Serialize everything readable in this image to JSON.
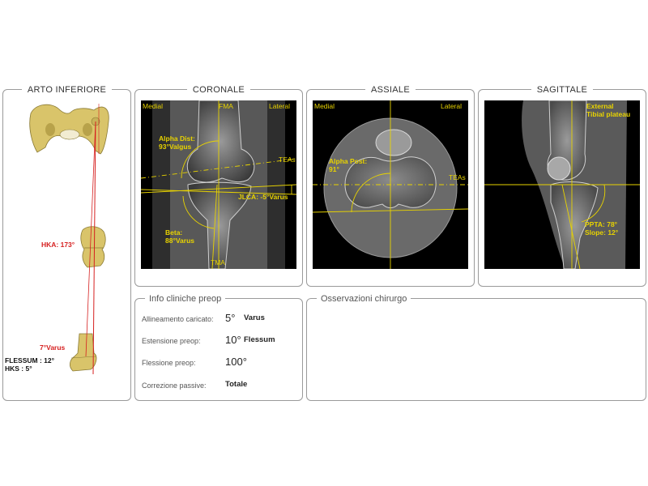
{
  "panels": {
    "lower_limb": {
      "title": "ARTO INFERIORE"
    },
    "coronal": {
      "title": "CORONALE"
    },
    "axial": {
      "title": "ASSIALE"
    },
    "sagittal": {
      "title": "SAGITTALE"
    },
    "clinical_info": {
      "title": "Info cliniche preop"
    },
    "surgeon_notes": {
      "title": "Osservazioni chirurgo"
    }
  },
  "lower_limb": {
    "hka": "HKA: 173°",
    "varus": "7°Varus",
    "flessum": "FLESSUM : 12°",
    "hks": "HKS : 5°"
  },
  "coronal": {
    "medial": "Medial",
    "fma": "FMA",
    "lateral": "Lateral",
    "alpha_dist": "Alpha Dist:",
    "alpha_dist_value": "93°Valgus",
    "teas": "TEAs",
    "jlca": "JLCA: -5°Varus",
    "beta": "Beta:",
    "beta_value": "88°Varus",
    "tma": "TMA"
  },
  "axial": {
    "medial": "Medial",
    "lateral": "Lateral",
    "alpha_post": "Alpha Post:",
    "alpha_post_value": "91°",
    "teas": "TEAs"
  },
  "sagittal": {
    "external": "External",
    "tibial_plateau": "Tibial plateau",
    "ppta": "PPTA: 78°",
    "slope": "Slope: 12°"
  },
  "clinical_info": {
    "rows": [
      {
        "label": "Allineamento caricato:",
        "value": "5°",
        "desc": "Varus"
      },
      {
        "label": "Estensione preop:",
        "value": "10°",
        "desc": "Flessum"
      },
      {
        "label": "Flessione preop:",
        "value": "100°",
        "desc": ""
      },
      {
        "label": "Correzione passive:",
        "value": "",
        "desc": "Totale"
      }
    ]
  },
  "colors": {
    "overlay": "#e8d300",
    "annotation_red": "#d62020",
    "border": "#9a9a9a",
    "bone": "#d9c46a"
  }
}
